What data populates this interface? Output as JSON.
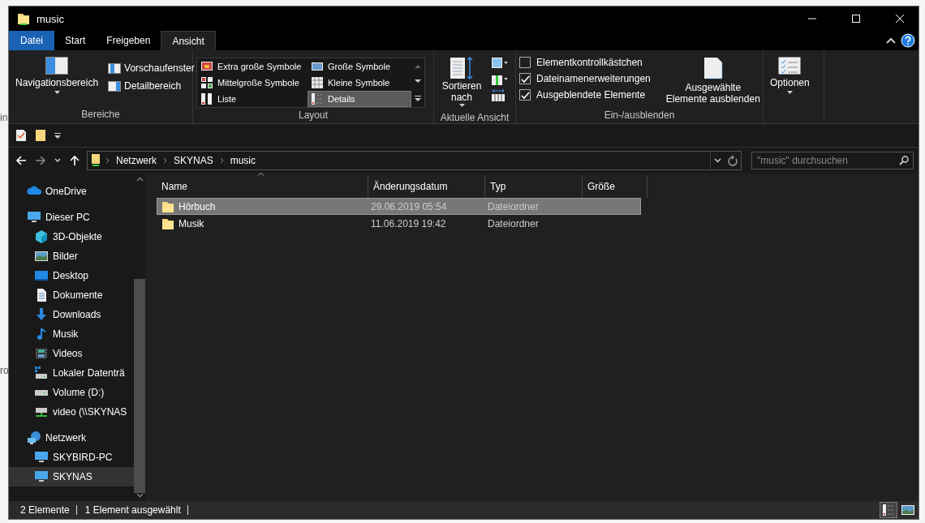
{
  "background": {
    "fragments": [
      "in",
      "ro"
    ]
  },
  "window": {
    "title": "music"
  },
  "ribbon_tabs": [
    {
      "label": "Datei",
      "kind": "file",
      "selected": false
    },
    {
      "label": "Start",
      "kind": "tab",
      "selected": false
    },
    {
      "label": "Freigeben",
      "kind": "tab",
      "selected": false
    },
    {
      "label": "Ansicht",
      "kind": "tab",
      "selected": true
    }
  ],
  "ribbon": {
    "panes": {
      "nav_pane_button": "Navigationsbereich",
      "items": [
        "Vorschaufenster",
        "Detailbereich"
      ],
      "label": "Bereiche"
    },
    "layout": {
      "options": [
        {
          "label": "Extra große Symbole",
          "kind": "xl",
          "selected": false
        },
        {
          "label": "Große Symbole",
          "kind": "large",
          "selected": false
        },
        {
          "label": "Mittelgroße Symbole",
          "kind": "medium",
          "selected": false
        },
        {
          "label": "Kleine Symbole",
          "kind": "small",
          "selected": false
        },
        {
          "label": "Liste",
          "kind": "list",
          "selected": false
        },
        {
          "label": "Details",
          "kind": "details",
          "selected": true
        }
      ],
      "label": "Layout"
    },
    "current_view": {
      "sort_button": "Sortieren nach",
      "label": "Aktuelle Ansicht"
    },
    "show_hide": {
      "checkboxes": [
        {
          "label": "Elementkontrollkästchen",
          "checked": false
        },
        {
          "label": "Dateinamenerweiterungen",
          "checked": true
        },
        {
          "label": "Ausgeblendete Elemente",
          "checked": true
        }
      ],
      "hide_button": "Ausgewählte Elemente ausblenden",
      "label": "Ein-/ausblenden"
    },
    "options_button": "Optionen"
  },
  "breadcrumb": [
    "Netzwerk",
    "SKYNAS",
    "music"
  ],
  "search": {
    "placeholder": "\"music\" durchsuchen"
  },
  "sidebar": {
    "items": [
      {
        "label": "OneDrive",
        "kind": "cloud",
        "selected": false
      },
      {
        "label": "Dieser PC",
        "kind": "pc",
        "selected": false,
        "children": [
          {
            "label": "3D-Objekte",
            "kind": "cube",
            "selected": false
          },
          {
            "label": "Bilder",
            "kind": "pictures",
            "selected": false
          },
          {
            "label": "Desktop",
            "kind": "desktop",
            "selected": false
          },
          {
            "label": "Dokumente",
            "kind": "documents",
            "selected": false
          },
          {
            "label": "Downloads",
            "kind": "download",
            "selected": false
          },
          {
            "label": "Musik",
            "kind": "music",
            "selected": false
          },
          {
            "label": "Videos",
            "kind": "video",
            "selected": false
          },
          {
            "label": "Lokaler Datenträ",
            "kind": "windrive",
            "selected": false
          },
          {
            "label": "Volume (D:)",
            "kind": "drive",
            "selected": false
          },
          {
            "label": "video (\\\\SKYNAS",
            "kind": "netdrive",
            "selected": false
          }
        ]
      },
      {
        "label": "Netzwerk",
        "kind": "network",
        "selected": false,
        "children": [
          {
            "label": "SKYBIRD-PC",
            "kind": "computer",
            "selected": false
          },
          {
            "label": "SKYNAS",
            "kind": "computer",
            "selected": true
          }
        ]
      }
    ]
  },
  "table": {
    "columns": [
      "Name",
      "Änderungsdatum",
      "Typ",
      "Größe"
    ],
    "rows": [
      {
        "name": "Hörbuch",
        "date": "29.06.2019 05:54",
        "type": "Dateiordner",
        "selected": true
      },
      {
        "name": "Musik",
        "date": "11.06.2019 19:42",
        "type": "Dateiordner",
        "selected": false
      }
    ]
  },
  "status_bar": [
    "2 Elemente",
    "1 Element ausgewählt"
  ],
  "view_buttons": [
    {
      "kind": "details",
      "selected": true
    },
    {
      "kind": "preview",
      "selected": false
    }
  ]
}
